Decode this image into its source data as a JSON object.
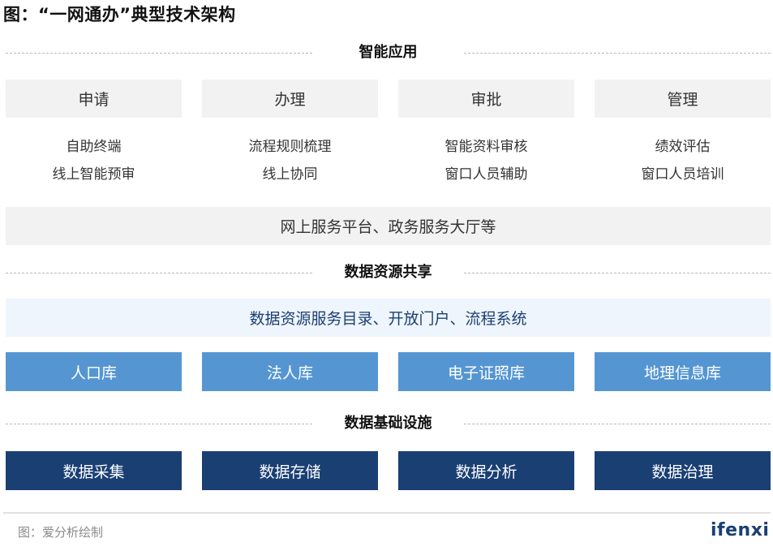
{
  "title": "图：“一网通办”典型技术架构",
  "colors": {
    "gray_box": "#f2f2f2",
    "light_blue_box": "#eef5fc",
    "mid_blue_box": "#5596d2",
    "dark_blue_box": "#1a3f73",
    "dashed_line": "#b8b8b8"
  },
  "layers": {
    "application": {
      "label": "智能应用",
      "categories": [
        {
          "name": "申请",
          "items": [
            "自助终端",
            "线上智能预审"
          ]
        },
        {
          "name": "办理",
          "items": [
            "流程规则梳理",
            "线上协同"
          ]
        },
        {
          "name": "审批",
          "items": [
            "智能资料审核",
            "窗口人员辅助"
          ]
        },
        {
          "name": "管理",
          "items": [
            "绩效评估",
            "窗口人员培训"
          ]
        }
      ],
      "platform": "网上服务平台、政务服务大厅等"
    },
    "sharing": {
      "label": "数据资源共享",
      "catalog": "数据资源服务目录、开放门户、流程系统",
      "databases": [
        "人口库",
        "法人库",
        "电子证照库",
        "地理信息库"
      ]
    },
    "infrastructure": {
      "label": "数据基础设施",
      "items": [
        "数据采集",
        "数据存储",
        "数据分析",
        "数据治理"
      ]
    }
  },
  "footer": {
    "source": "图：爱分析绘制",
    "logo": "ifenxi"
  }
}
